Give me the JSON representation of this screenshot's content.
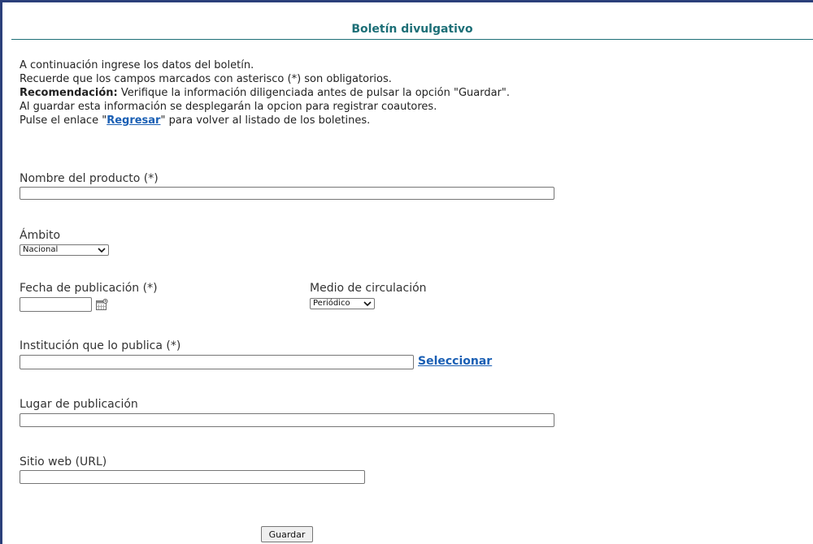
{
  "page": {
    "title": "Boletín divulgativo"
  },
  "intro": {
    "line1": "A continuación ingrese los datos del boletín.",
    "line2": "Recuerde que los campos marcados con asterisco (*) son obligatorios.",
    "line3_bold": "Recomendación:",
    "line3_rest": " Verifique la información diligenciada antes de pulsar la opción \"Guardar\".",
    "line4": "Al guardar esta información se desplegarán la opcion para registrar coautores.",
    "line5_pre": "Pulse el enlace \"",
    "line5_link": "Regresar",
    "line5_post": "\" para volver al listado de los boletines."
  },
  "form": {
    "product_name": {
      "label": "Nombre del producto (*)",
      "value": ""
    },
    "scope": {
      "label": "Ámbito",
      "selected": "Nacional"
    },
    "publication_date": {
      "label": "Fecha de publicación (*)",
      "value": ""
    },
    "circulation": {
      "label": "Medio de circulación",
      "selected": "Periódico"
    },
    "institution": {
      "label": "Institución que lo publica (*)",
      "value": "",
      "select_link": "Seleccionar"
    },
    "place": {
      "label": "Lugar de publicación",
      "value": ""
    },
    "website": {
      "label": "Sitio web (URL)",
      "value": ""
    }
  },
  "actions": {
    "save_label": "Guardar"
  },
  "icons": {
    "calendar": "calendar-icon",
    "dropdown": "chevron-down-icon"
  },
  "colors": {
    "title": "#1d6f77",
    "link": "#1a5fb4",
    "frame": "#2b3f7a"
  }
}
